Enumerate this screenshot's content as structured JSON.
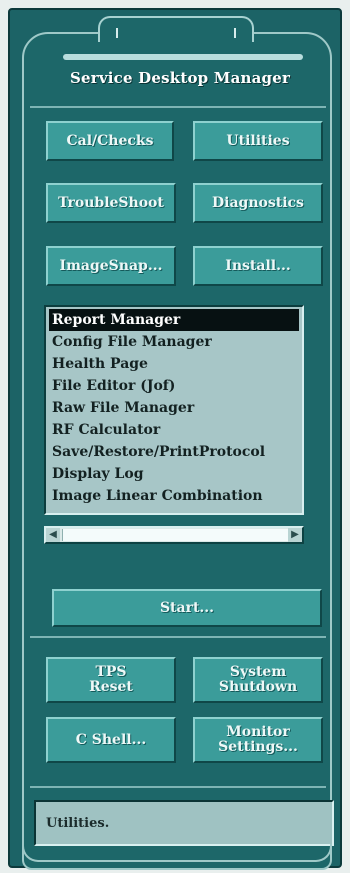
{
  "header": {
    "title": "Service Desktop Manager"
  },
  "buttons": {
    "cal_checks": "Cal/Checks",
    "utilities": "Utilities",
    "troubleshoot": "TroubleShoot",
    "diagnostics": "Diagnostics",
    "imagesnap": "ImageSnap...",
    "install": "Install...",
    "start": "Start...",
    "tps_reset_line1": "TPS",
    "tps_reset_line2": "Reset",
    "system_shutdown_line1": "System",
    "system_shutdown_line2": "Shutdown",
    "c_shell": "C Shell...",
    "monitor_settings_line1": "Monitor",
    "monitor_settings_line2": "Settings..."
  },
  "list": {
    "items": [
      "Report Manager",
      "Config File Manager",
      "Health Page",
      "File Editor (Jof)",
      "Raw File Manager",
      "RF Calculator",
      "Save/Restore/PrintProtocol",
      "Display Log",
      "Image Linear Combination"
    ],
    "selected": "Report Manager"
  },
  "status": {
    "text": "Utilities."
  },
  "colors": {
    "panel": "#1d6769",
    "button": "#3b9c9a",
    "list_background": "#a7c6c7",
    "selection": "#071112"
  }
}
